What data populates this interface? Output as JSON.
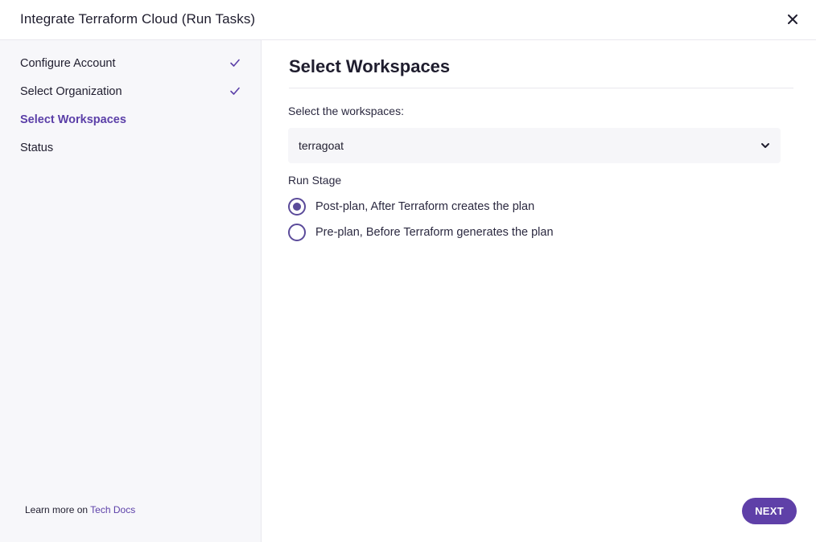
{
  "header": {
    "title": "Integrate Terraform Cloud (Run Tasks)",
    "close_icon": "close-icon"
  },
  "sidebar": {
    "steps": [
      {
        "label": "Configure Account",
        "state": "completed",
        "icon": "check-icon"
      },
      {
        "label": "Select Organization",
        "state": "completed",
        "icon": "check-icon"
      },
      {
        "label": "Select Workspaces",
        "state": "active"
      },
      {
        "label": "Status",
        "state": "pending"
      }
    ],
    "footer": {
      "prefix": "Learn more on",
      "link": "Tech Docs"
    }
  },
  "main": {
    "title": "Select Workspaces",
    "workspaces_label": "Select the workspaces:",
    "workspace_select": {
      "value": "terragoat",
      "icon": "chevron-down-icon"
    },
    "run_stage": {
      "label": "Run Stage",
      "options": [
        {
          "label": "Post-plan, After Terraform creates the plan",
          "selected": true
        },
        {
          "label": "Pre-plan, Before Terraform generates the plan",
          "selected": false
        }
      ]
    },
    "next_label": "NEXT"
  },
  "colors": {
    "accent": "#5f40a8",
    "active_step_text": "#5b3fa8",
    "sidebar_bg": "#f7f7fa",
    "select_bg": "#f6f6f9",
    "radio": "#5b4b9a"
  }
}
